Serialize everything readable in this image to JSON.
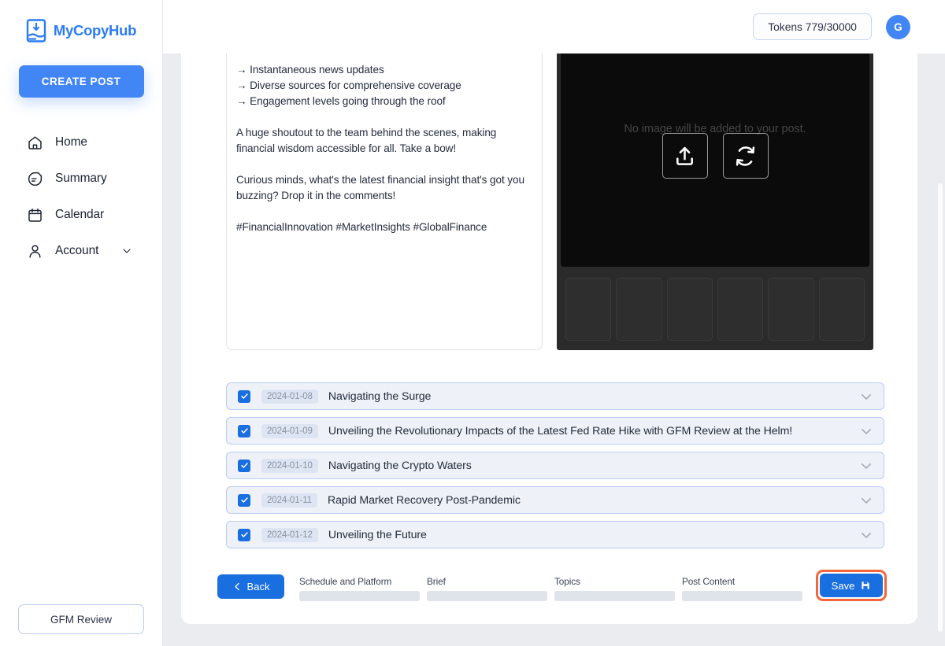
{
  "brand": {
    "name": "MyCopyHub",
    "logo_icon": "document-hand-logo-icon",
    "accent_color": "#2b7cf6"
  },
  "sidebar": {
    "create_post_label": "CREATE POST",
    "items": [
      {
        "label": "Home",
        "icon": "home-icon",
        "has_chevron": false
      },
      {
        "label": "Summary",
        "icon": "document-icon",
        "has_chevron": false
      },
      {
        "label": "Calendar",
        "icon": "calendar-icon",
        "has_chevron": false
      },
      {
        "label": "Account",
        "icon": "person-icon",
        "has_chevron": true
      }
    ],
    "footer_button_label": "GFM Review"
  },
  "header": {
    "tokens_label": "Tokens 779/30000",
    "avatar_initial": "G",
    "avatar_color": "#4285f4"
  },
  "editor": {
    "content": "→ Instantaneous news updates\n→ Diverse sources for comprehensive coverage\n→ Engagement levels going through the roof\n\nA huge shoutout to the team behind the scenes, making financial wisdom accessible for all. Take a bow!\n\nCurious minds, what's the latest financial insight that's got you buzzing? Drop it in the comments!\n\n#FinancialInnovation #MarketInsights #GlobalFinance"
  },
  "image_panel": {
    "empty_message": "No image will be added to your post.",
    "upload_icon": "upload-icon",
    "regenerate_icon": "refresh-icon",
    "thumbnail_count": 6
  },
  "post_list": [
    {
      "checked": true,
      "date": "2024-01-08",
      "title": "Navigating the Surge"
    },
    {
      "checked": true,
      "date": "2024-01-09",
      "title": "Unveiling the Revolutionary Impacts of the Latest Fed Rate Hike with GFM Review at the Helm!"
    },
    {
      "checked": true,
      "date": "2024-01-10",
      "title": "Navigating the Crypto Waters"
    },
    {
      "checked": true,
      "date": "2024-01-11",
      "title": "Rapid Market Recovery Post-Pandemic"
    },
    {
      "checked": true,
      "date": "2024-01-12",
      "title": "Unveiling the Future"
    }
  ],
  "toolbar": {
    "back_label": "Back",
    "back_icon": "chevron-left-icon",
    "save_label": "Save",
    "save_icon": "floppy-disk-icon",
    "save_highlight_color": "#f4663a",
    "steps": [
      {
        "label": "Schedule and Platform",
        "progress": 100
      },
      {
        "label": "Brief",
        "progress": 100
      },
      {
        "label": "Topics",
        "progress": 100
      },
      {
        "label": "Post Content",
        "progress": 100
      }
    ]
  }
}
